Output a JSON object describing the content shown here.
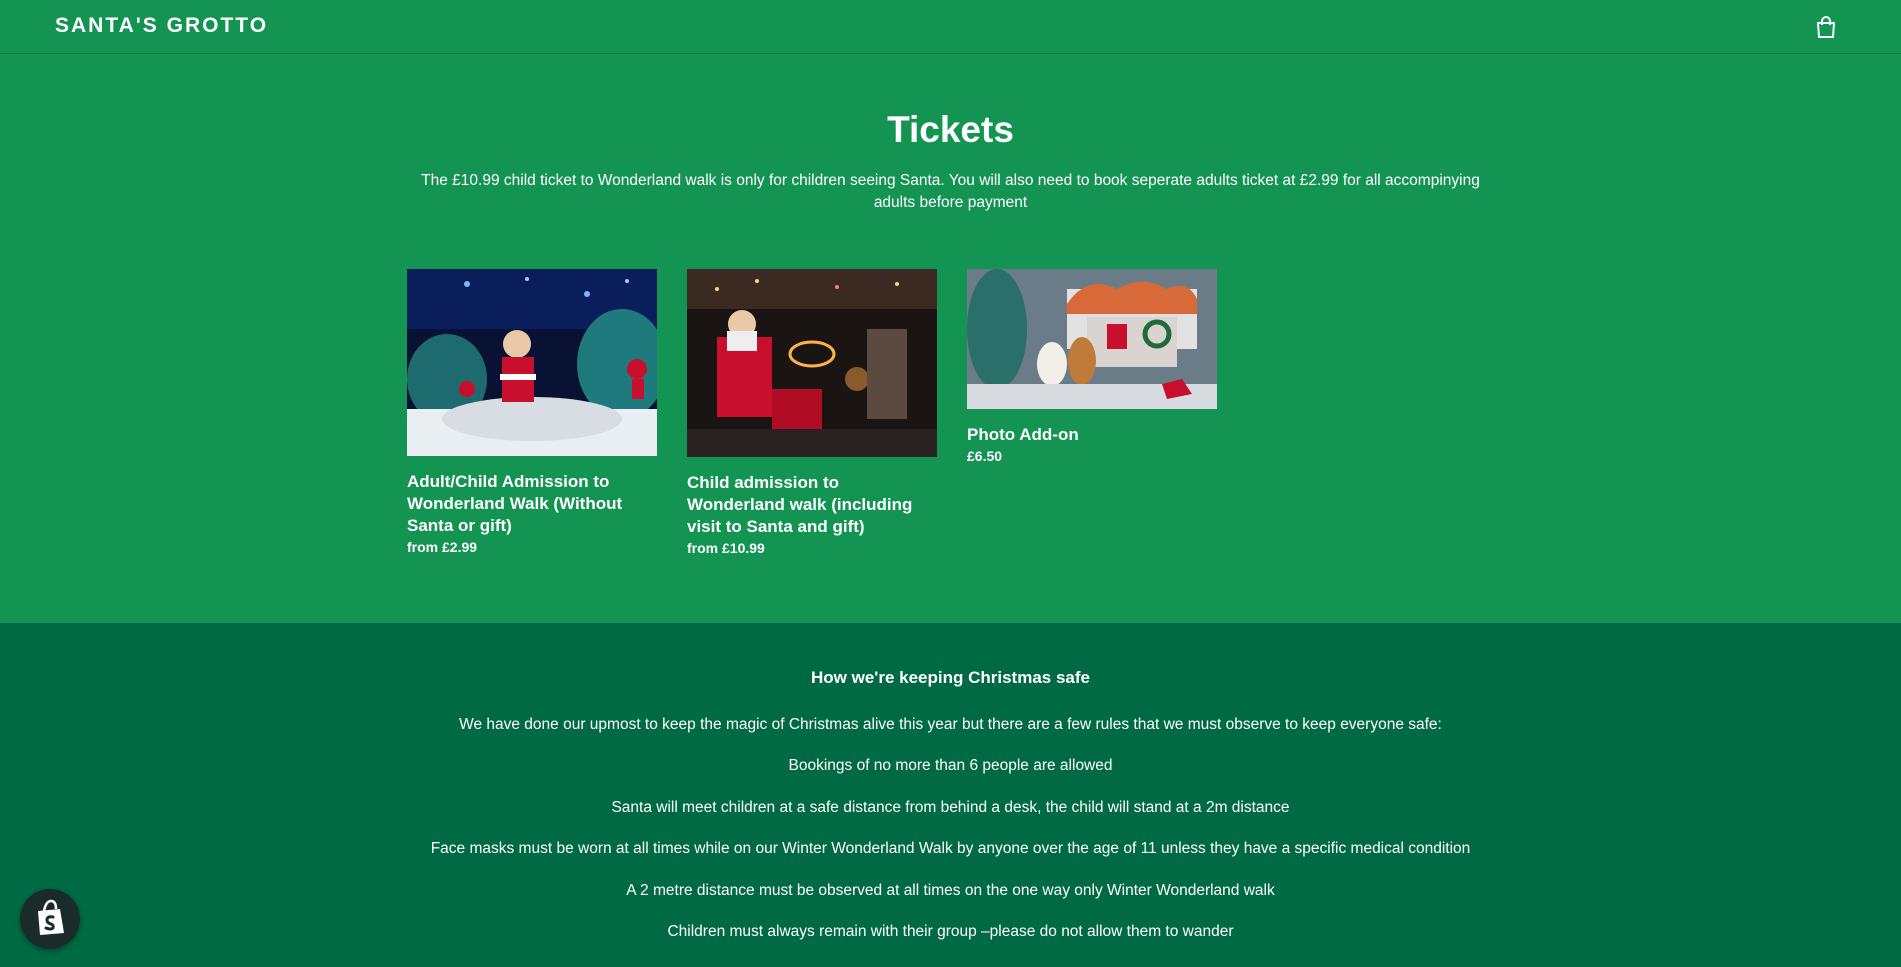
{
  "header": {
    "logo": "SANTA'S GROTTO",
    "cart_icon": "shopping-bag-icon"
  },
  "main": {
    "title": "Tickets",
    "intro": "The £10.99 child ticket to Wonderland walk is only for children seeing Santa. You will also need to book seperate adults ticket at £2.99 for all accompinying adults before payment",
    "products": [
      {
        "name": "Adult/Child Admission to Wonderland Walk (Without Santa or gift)",
        "price": "from £2.99"
      },
      {
        "name": "Child admission to Wonderland walk (including visit to Santa and gift)",
        "price": "from £10.99"
      },
      {
        "name": "Photo Add-on",
        "price": "£6.50"
      }
    ]
  },
  "footer": {
    "title": "How we're keeping Christmas safe",
    "rules": [
      "We have done our upmost to keep the magic of Christmas alive this year but there are a few rules that we must observe to keep everyone safe:",
      "Bookings of no more than 6 people are allowed",
      "Santa will meet children at a safe distance from behind a desk, the child will stand at a 2m distance",
      "Face masks must be worn at all times while on our Winter Wonderland Walk by anyone over the age of 11 unless they have a specific medical condition",
      "A 2 metre distance must be observed at all times on the one way only Winter Wonderland walk",
      "Children must always remain with their group –please do not allow them to wander"
    ]
  },
  "badge": {
    "icon": "shopify-bag-icon"
  },
  "colors": {
    "page_bg": "#139452",
    "footer_bg": "#006a44",
    "text": "#ffffff"
  }
}
